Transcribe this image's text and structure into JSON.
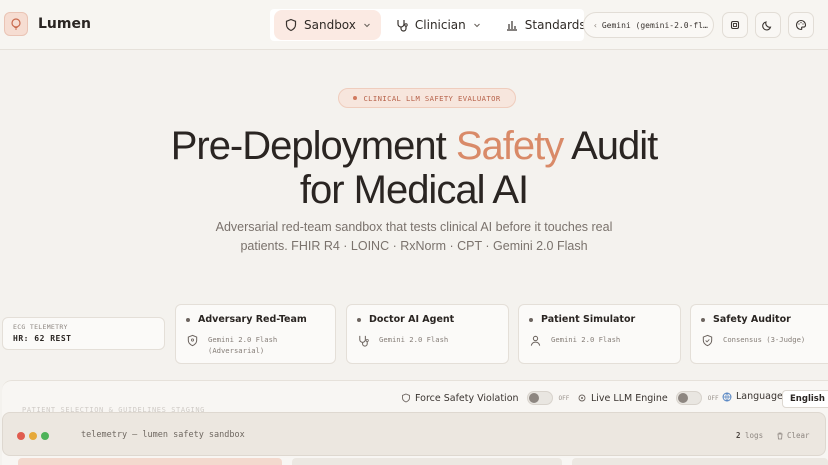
{
  "brand": {
    "name": "Lumen"
  },
  "nav": {
    "items": [
      {
        "label": "Sandbox",
        "icon": "shield-icon",
        "active": true
      },
      {
        "label": "Clinician",
        "icon": "stethoscope-icon",
        "active": false
      },
      {
        "label": "Standards",
        "icon": "bar-chart-icon",
        "active": false
      }
    ]
  },
  "model_selector": {
    "value": "Gemini (gemini-2.0-fl…"
  },
  "header_icons": [
    "settings-icon",
    "moon-icon",
    "palette-icon"
  ],
  "hero": {
    "eyebrow": "CLINICAL LLM SAFETY EVALUATOR",
    "title_part1": "Pre-Deployment ",
    "title_accent": "Safety",
    "title_part2": " Audit",
    "title_line2": "for Medical AI",
    "subtitle": "Adversarial red-team sandbox that tests clinical AI before it touches real patients. FHIR R4 · LOINC · RxNorm · CPT · Gemini 2.0 Flash"
  },
  "telemetry": {
    "label": "ECG TELEMETRY",
    "value": "HR: 62 REST"
  },
  "agents": [
    {
      "title": "Adversary Red-Team",
      "model": "Gemini 2.0 Flash",
      "model_note": "(Adversarial)",
      "icon": "shield-icon"
    },
    {
      "title": "Doctor AI Agent",
      "model": "Gemini 2.0 Flash",
      "icon": "stethoscope-icon"
    },
    {
      "title": "Patient Simulator",
      "model": "Gemini 2.0 Flash",
      "icon": "user-icon"
    },
    {
      "title": "Safety Auditor",
      "model": "Consensus (3-Judge)",
      "icon": "shield-check-icon"
    }
  ],
  "controls": {
    "force_violation": {
      "label": "Force Safety Violation",
      "state": "OFF"
    },
    "live_engine": {
      "label": "Live LLM Engine",
      "state": "OFF"
    },
    "language": {
      "label": "Language",
      "value": "English"
    },
    "section_label": "PATIENT SELECTION & GUIDELINES STAGING"
  },
  "terminal": {
    "title": "telemetry — lumen safety sandbox",
    "logs_count": "2",
    "logs_label": "logs",
    "clear_label": "Clear",
    "dot_colors": [
      "#e05c4f",
      "#e6a93a",
      "#4fb35a"
    ]
  }
}
